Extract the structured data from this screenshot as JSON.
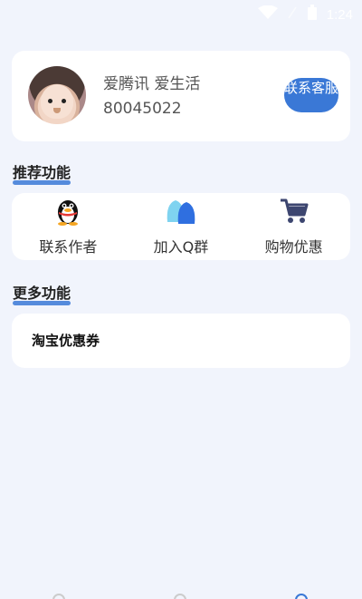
{
  "status": {
    "time": "1:24"
  },
  "profile": {
    "name": "爱腾讯 爱生活",
    "id": "80045022",
    "contact_label": "联系客服"
  },
  "sections": {
    "recommended_title": "推荐功能",
    "more_title": "更多功能"
  },
  "features": [
    {
      "label": "联系作者",
      "icon": "qq-penguin-icon"
    },
    {
      "label": "加入Q群",
      "icon": "qq-group-icon"
    },
    {
      "label": "购物优惠",
      "icon": "shopping-cart-icon"
    }
  ],
  "more_items": [
    {
      "label": "淘宝优惠券"
    }
  ],
  "colors": {
    "background": "#f1f4fc",
    "accent": "#3a78d6"
  }
}
